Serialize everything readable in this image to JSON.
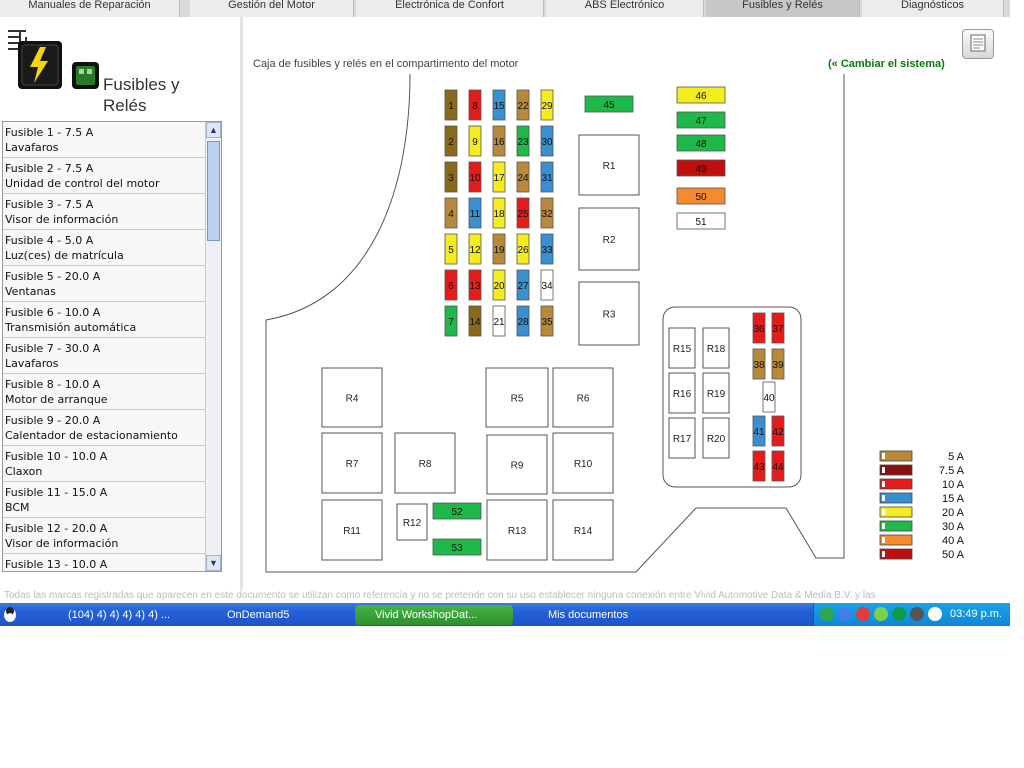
{
  "tabs": [
    {
      "label": "Manuales de Reparación",
      "active": false
    },
    {
      "label": "Gestión del Motor",
      "active": false
    },
    {
      "label": "Electrónica de Confort",
      "active": false
    },
    {
      "label": "ABS Electrónico",
      "active": false
    },
    {
      "label": "Fusibles y Relés",
      "active": true
    },
    {
      "label": "Diagnósticos",
      "active": false
    }
  ],
  "section": {
    "title": "Fusibles y Relés"
  },
  "fuse_list": [
    {
      "title": "Fusible 1 - 7.5 A",
      "desc": "Lavafaros"
    },
    {
      "title": "Fusible 2 - 7.5 A",
      "desc": "Unidad de control del motor"
    },
    {
      "title": "Fusible 3 - 7.5 A",
      "desc": "Visor de información"
    },
    {
      "title": "Fusible 4 - 5.0 A",
      "desc": "Luz(ces) de matrícula"
    },
    {
      "title": "Fusible 5 - 20.0 A",
      "desc": "Ventanas"
    },
    {
      "title": "Fusible 6 - 10.0 A",
      "desc": "Transmisión automática"
    },
    {
      "title": "Fusible 7 - 30.0 A",
      "desc": "Lavafaros"
    },
    {
      "title": "Fusible 8 - 10.0 A",
      "desc": "Motor de arranque"
    },
    {
      "title": "Fusible 9 - 20.0 A",
      "desc": "Calentador de estacionamiento"
    },
    {
      "title": "Fusible 10 - 10.0 A",
      "desc": "Claxon"
    },
    {
      "title": "Fusible 11 - 15.0 A",
      "desc": "BCM"
    },
    {
      "title": "Fusible 12 - 20.0 A",
      "desc": "Visor de información"
    },
    {
      "title": "Fusible 13 - 10.0 A",
      "desc": ""
    }
  ],
  "main": {
    "caption": "Caja de fusibles y relés en el compartimento del motor",
    "change_link": "(« Cambiar el sistema)"
  },
  "colors": {
    "5A": "#b8893a",
    "7.5A": "#8a1010",
    "10A": "#e61b1b",
    "15A": "#3a8fd0",
    "20A": "#f5ec20",
    "30A": "#1fb84a",
    "40A": "#f58a2e",
    "50A": "#c00e0e",
    "brown": "#8a6a1a",
    "white": "#ffffff"
  },
  "fuses": [
    {
      "n": "1",
      "c": "brown"
    },
    {
      "n": "2",
      "c": "brown"
    },
    {
      "n": "3",
      "c": "brown"
    },
    {
      "n": "4",
      "c": "5A"
    },
    {
      "n": "5",
      "c": "20A"
    },
    {
      "n": "6",
      "c": "10A"
    },
    {
      "n": "7",
      "c": "30A"
    },
    {
      "n": "8",
      "c": "10A"
    },
    {
      "n": "9",
      "c": "20A"
    },
    {
      "n": "10",
      "c": "10A"
    },
    {
      "n": "11",
      "c": "15A"
    },
    {
      "n": "12",
      "c": "20A"
    },
    {
      "n": "13",
      "c": "10A"
    },
    {
      "n": "14",
      "c": "brown"
    },
    {
      "n": "15",
      "c": "15A"
    },
    {
      "n": "16",
      "c": "5A"
    },
    {
      "n": "17",
      "c": "20A"
    },
    {
      "n": "18",
      "c": "20A"
    },
    {
      "n": "19",
      "c": "5A"
    },
    {
      "n": "20",
      "c": "20A"
    },
    {
      "n": "21",
      "c": "white"
    },
    {
      "n": "22",
      "c": "5A"
    },
    {
      "n": "23",
      "c": "30A"
    },
    {
      "n": "24",
      "c": "5A"
    },
    {
      "n": "25",
      "c": "10A"
    },
    {
      "n": "26",
      "c": "20A"
    },
    {
      "n": "27",
      "c": "15A"
    },
    {
      "n": "28",
      "c": "15A"
    },
    {
      "n": "29",
      "c": "20A"
    },
    {
      "n": "30",
      "c": "15A"
    },
    {
      "n": "31",
      "c": "15A"
    },
    {
      "n": "32",
      "c": "5A"
    },
    {
      "n": "33",
      "c": "15A"
    },
    {
      "n": "34",
      "c": "white"
    },
    {
      "n": "35",
      "c": "5A"
    },
    {
      "n": "36",
      "c": "10A"
    },
    {
      "n": "37",
      "c": "10A"
    },
    {
      "n": "38",
      "c": "5A"
    },
    {
      "n": "39",
      "c": "5A"
    },
    {
      "n": "40",
      "c": "white"
    },
    {
      "n": "41",
      "c": "15A"
    },
    {
      "n": "42",
      "c": "10A"
    },
    {
      "n": "43",
      "c": "10A"
    },
    {
      "n": "44",
      "c": "10A"
    },
    {
      "n": "45",
      "c": "30A"
    },
    {
      "n": "46",
      "c": "20A"
    },
    {
      "n": "47",
      "c": "30A"
    },
    {
      "n": "48",
      "c": "30A"
    },
    {
      "n": "49",
      "c": "50A"
    },
    {
      "n": "50",
      "c": "40A"
    },
    {
      "n": "51",
      "c": "white"
    },
    {
      "n": "52",
      "c": "30A"
    },
    {
      "n": "53",
      "c": "30A"
    }
  ],
  "relays": [
    "R1",
    "R2",
    "R3",
    "R4",
    "R5",
    "R6",
    "R7",
    "R8",
    "R9",
    "R10",
    "R11",
    "R12",
    "R13",
    "R14",
    "R15",
    "R16",
    "R17",
    "R18",
    "R19",
    "R20"
  ],
  "legend": [
    {
      "label": "5 A",
      "c": "5A"
    },
    {
      "label": "7.5 A",
      "c": "7.5A"
    },
    {
      "label": "10 A",
      "c": "10A"
    },
    {
      "label": "15 A",
      "c": "15A"
    },
    {
      "label": "20 A",
      "c": "20A"
    },
    {
      "label": "30 A",
      "c": "30A"
    },
    {
      "label": "40 A",
      "c": "40A"
    },
    {
      "label": "50 A",
      "c": "50A"
    }
  ],
  "footer": "Todas las marcas registradas que aparecen en este documento se utilizan como referencia y no se pretende con su uso establecer ninguna conexión entre Vivid Automotive Data & Media B.V. y las",
  "taskbar": {
    "items": [
      "(104) 4) 4) 4) 4) 4) ...",
      "OnDemand5",
      "Vivid WorkshopDat...",
      "Mis documentos"
    ],
    "clock": "03:49 p.m."
  }
}
